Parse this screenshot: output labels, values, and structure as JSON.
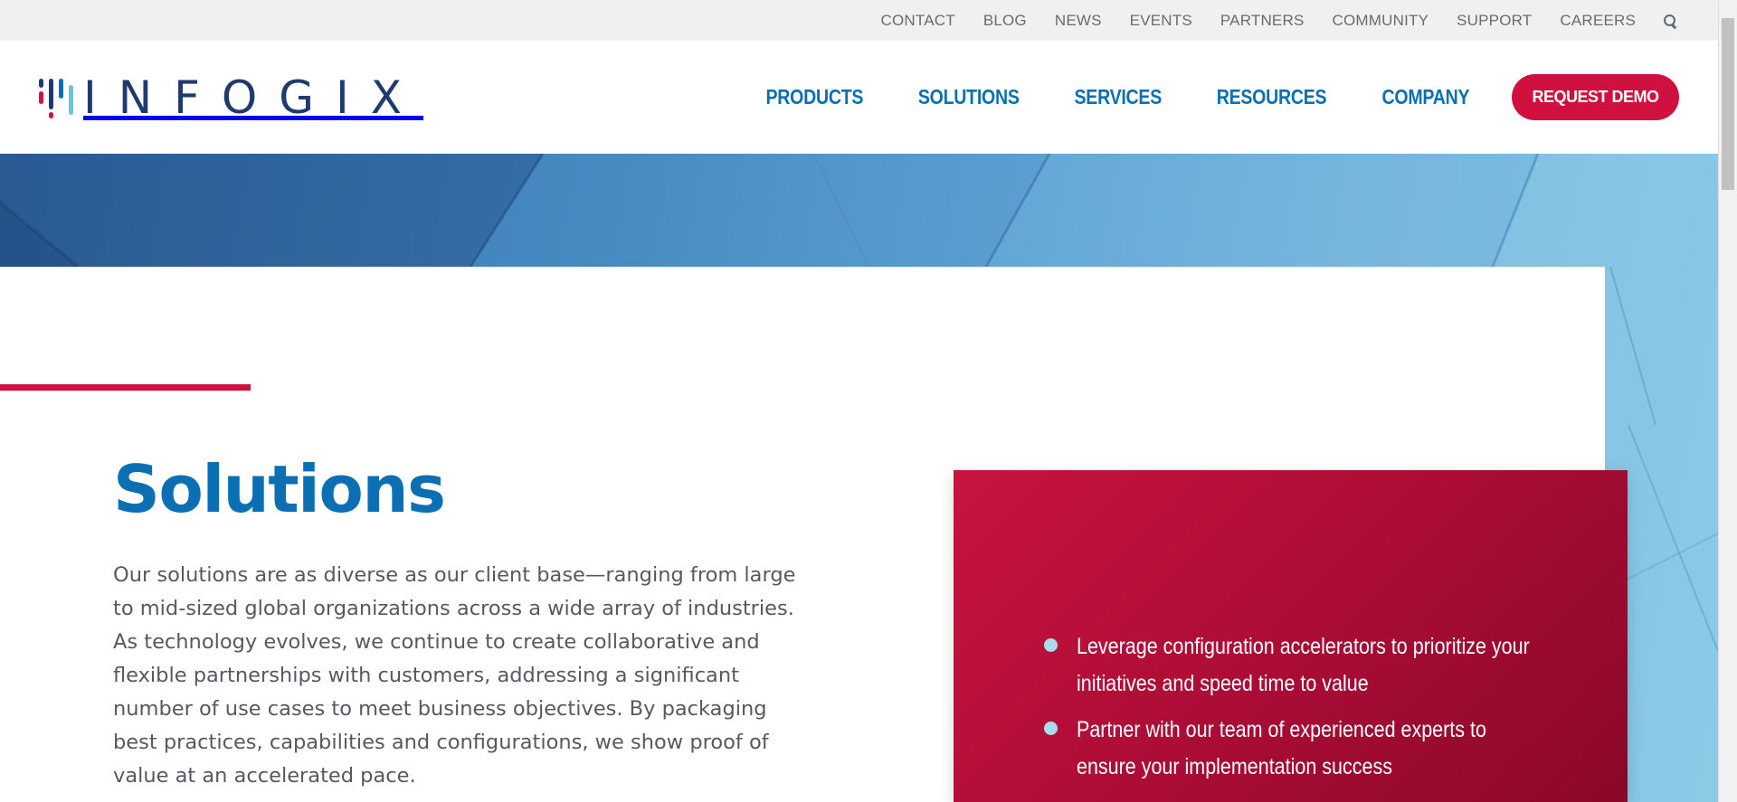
{
  "utility_nav": {
    "links": [
      "CONTACT",
      "BLOG",
      "NEWS",
      "EVENTS",
      "PARTNERS",
      "COMMUNITY",
      "SUPPORT",
      "CAREERS"
    ],
    "search_icon": "search-icon"
  },
  "header": {
    "logo_text": "INFOGIX",
    "nav": [
      "PRODUCTS",
      "SOLUTIONS",
      "SERVICES",
      "RESOURCES",
      "COMPANY"
    ],
    "cta_label": "REQUEST DEMO"
  },
  "main": {
    "title": "Solutions",
    "intro": "Our solutions are as diverse as our client base—ranging from large to mid-sized global organizations across a wide array of industries. As technology evolves, we continue to create collaborative and flexible partnerships with customers, addressing a significant number of use cases to meet business objectives. By packaging best practices, capabilities and configurations, we show proof of value at an accelerated pace."
  },
  "feature_box": {
    "items": [
      "Leverage configuration accelerators to prioritize your initiatives and speed time to value",
      "Partner with our team of experienced experts to ensure your implementation success"
    ]
  },
  "colors": {
    "brand_blue": "#0a70b3",
    "brand_navy": "#1f3a6e",
    "brand_red": "#d0103f",
    "bullet_cyan": "#a8dce8"
  }
}
